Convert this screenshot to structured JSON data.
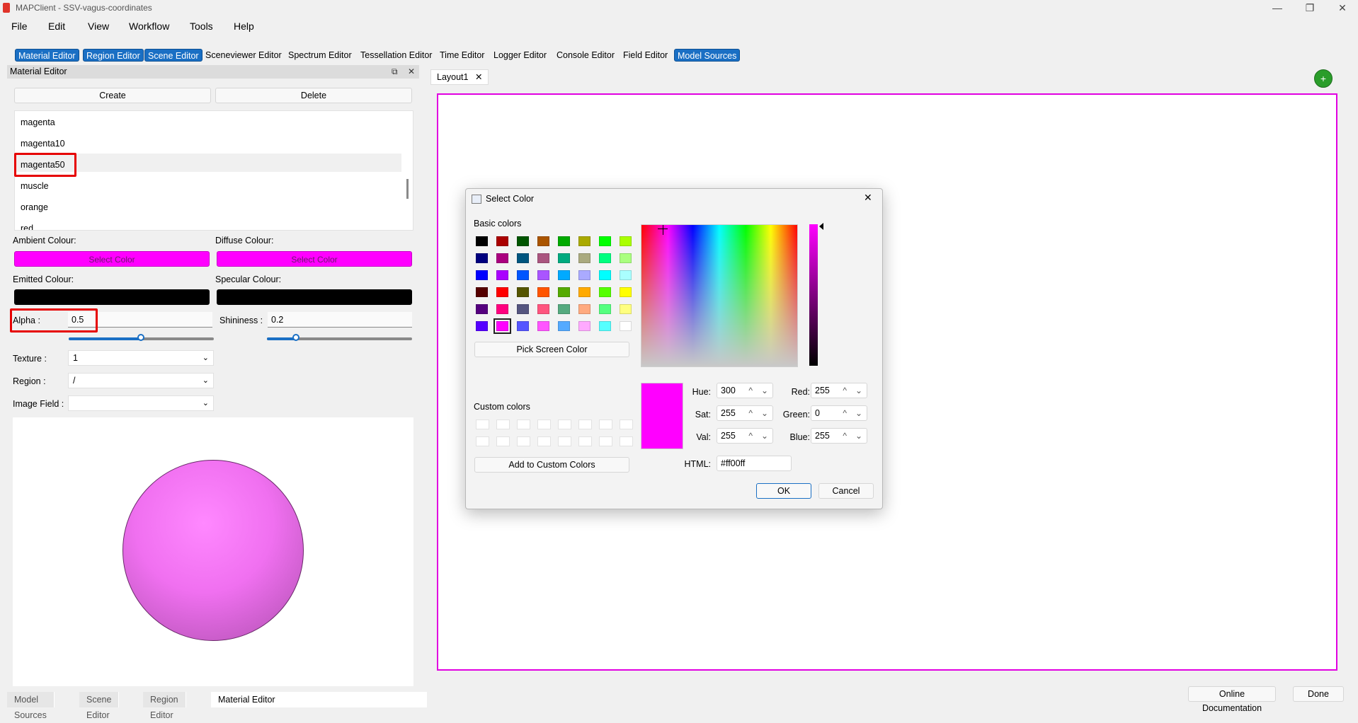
{
  "window": {
    "title": "MAPClient - SSV-vagus-coordinates",
    "minimize": "—",
    "maximize": "❐",
    "close": "✕"
  },
  "menu": [
    "File",
    "Edit",
    "View",
    "Workflow",
    "Tools",
    "Help"
  ],
  "toolbar": [
    "Material Editor",
    "Region Editor",
    "Scene Editor",
    "Sceneviewer Editor",
    "Spectrum Editor",
    "Tessellation Editor",
    "Time Editor",
    "Logger Editor",
    "Console Editor",
    "Field Editor",
    "Model Sources"
  ],
  "toolbar_active": [
    true,
    true,
    true,
    false,
    false,
    false,
    false,
    false,
    false,
    false,
    true
  ],
  "material_editor": {
    "title": "Material Editor",
    "float_icon": "⧉",
    "close_icon": "✕",
    "create_label": "Create",
    "delete_label": "Delete",
    "materials": [
      "magenta",
      "magenta10",
      "magenta50",
      "muscle",
      "orange",
      "red"
    ],
    "selected_material": "magenta50",
    "ambient_label": "Ambient Colour:",
    "diffuse_label": "Diffuse Colour:",
    "emitted_label": "Emitted Colour:",
    "specular_label": "Specular Colour:",
    "select_color_label": "Select Color",
    "ambient_color": "#ff00ff",
    "diffuse_color": "#ff00ff",
    "emitted_color": "#000000",
    "specular_color": "#000000",
    "alpha_label": "Alpha :",
    "alpha_value": "0.5",
    "shininess_label": "Shininess :",
    "shininess_value": "0.2",
    "texture_label": "Texture :",
    "texture_value": "1",
    "region_label": "Region :",
    "region_value": "/",
    "image_field_label": "Image Field :",
    "image_field_value": ""
  },
  "bottom_tabs": [
    "Model Sources",
    "Scene Editor",
    "Region Editor",
    "Material Editor"
  ],
  "bottom_tab_active": "Material Editor",
  "layout": {
    "tab_label": "Layout1",
    "tab_close": "✕",
    "add_icon": "+"
  },
  "footer": {
    "online_docs": "Online Documentation",
    "done": "Done"
  },
  "select_color": {
    "title": "Select Color",
    "close": "✕",
    "basic_colors_label": "Basic colors",
    "basic_colors": [
      [
        "#000000",
        "#aa0000",
        "#005500",
        "#aa5500",
        "#00aa00",
        "#aaaa00",
        "#00ff00",
        "#aaff00"
      ],
      [
        "#00007f",
        "#aa007f",
        "#00557f",
        "#aa557f",
        "#00aa7f",
        "#aaaa7f",
        "#00ff7f",
        "#aaff7f"
      ],
      [
        "#0000ff",
        "#aa00ff",
        "#0055ff",
        "#aa55ff",
        "#00aaff",
        "#aaaaff",
        "#00ffff",
        "#aaffff"
      ],
      [
        "#550000",
        "#ff0000",
        "#555500",
        "#ff5500",
        "#55aa00",
        "#ffaa00",
        "#55ff00",
        "#ffff00"
      ],
      [
        "#55007f",
        "#ff007f",
        "#55557f",
        "#ff557f",
        "#55aa7f",
        "#ffaa7f",
        "#55ff7f",
        "#ffff7f"
      ],
      [
        "#5500ff",
        "#ff00ff",
        "#5555ff",
        "#ff55ff",
        "#55aaff",
        "#ffaaff",
        "#55ffff",
        "#ffffff"
      ]
    ],
    "pick_screen_label": "Pick Screen Color",
    "custom_colors_label": "Custom colors",
    "add_custom_label": "Add to Custom Colors",
    "hue_label": "Hue:",
    "hue_value": "300",
    "sat_label": "Sat:",
    "sat_value": "255",
    "val_label": "Val:",
    "val_value": "255",
    "red_label": "Red:",
    "red_value": "255",
    "green_label": "Green:",
    "green_value": "0",
    "blue_label": "Blue:",
    "blue_value": "255",
    "html_label": "HTML:",
    "html_value": "#ff00ff",
    "current_color": "#ff00ff",
    "ok_label": "OK",
    "cancel_label": "Cancel",
    "spin_up": "^",
    "spin_down": "⌄",
    "combo_arrow": "⌄"
  }
}
